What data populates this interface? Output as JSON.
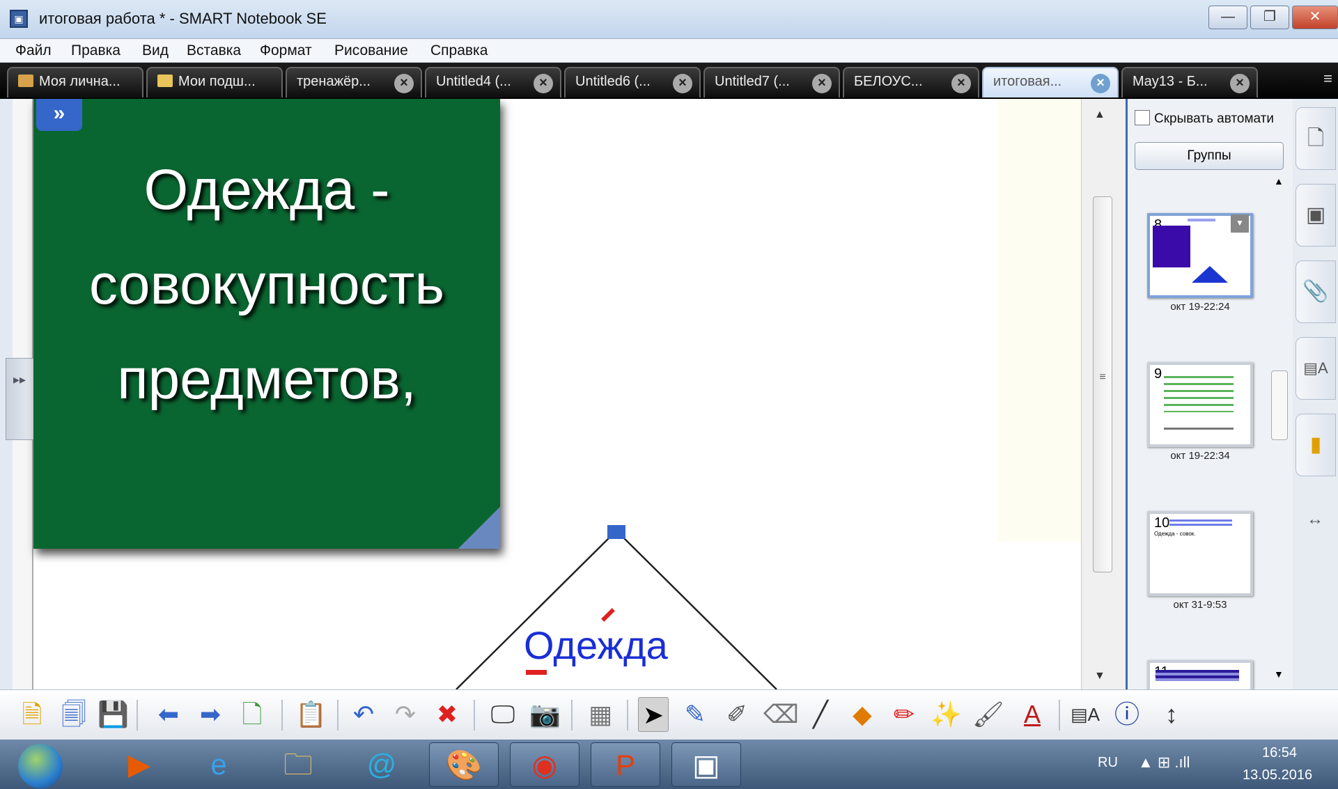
{
  "window": {
    "title": "итоговая работа * - SMART Notebook SE",
    "app_icon": "smart-notebook-icon",
    "minimize": "—",
    "restore": "❐",
    "close": "✕"
  },
  "menu": [
    "Файл",
    "Правка",
    "Вид",
    "Вставка",
    "Формат",
    "Рисование",
    "Справка"
  ],
  "tabs": [
    {
      "label": "Моя лична...",
      "icon": "house-icon"
    },
    {
      "label": "Мои подш...",
      "icon": "folder-icon"
    },
    {
      "label": "тренажёр...",
      "close": "×"
    },
    {
      "label": "Untitled4 (...",
      "close": "×"
    },
    {
      "label": "Untitled6 (...",
      "close": "×"
    },
    {
      "label": "Untitled7 (...",
      "close": "×"
    },
    {
      "label": "БЕЛОУС...",
      "close": "×"
    },
    {
      "label": "итоговая...",
      "close": "×",
      "active": true
    },
    {
      "label": "May13 - Б...",
      "close": "×"
    }
  ],
  "tabs_menu": "≡",
  "canvas": {
    "card_badge": "»",
    "card_lines": [
      "Одежда -",
      "совокупность",
      "предметов,"
    ],
    "card_color": "#0a6631",
    "triangle_word": "Одежда",
    "triangle_badge": "»"
  },
  "side_panel": {
    "autohide_label": "Скрывать автомати",
    "groups_button": "Группы",
    "thumbnails": [
      {
        "num": "8",
        "date": "окт 19-22:24",
        "selected": true
      },
      {
        "num": "9",
        "date": "окт 19-22:34"
      },
      {
        "num": "10",
        "date": "окт 31-9:53",
        "snippet": "Одежда - совок."
      },
      {
        "num": "11",
        "date": ""
      }
    ]
  },
  "right_tabs": [
    "page-sorter-icon",
    "gallery-icon",
    "attachments-icon",
    "properties-icon",
    "addons-icon"
  ],
  "right_tabs_extra": "↔",
  "toolbar": {
    "tools": [
      "new-page-icon",
      "add-page-icon",
      "save-icon",
      "back-arrow-icon",
      "forward-arrow-icon",
      "add-blank-page-icon",
      "paste-icon",
      "undo-icon",
      "redo-icon",
      "delete-icon",
      "screen-shade-icon",
      "screen-capture-icon",
      "table-icon",
      "select-icon",
      "pen-icon",
      "creative-pen-icon",
      "eraser-icon",
      "line-icon",
      "shapes-icon",
      "magic-pen-icon",
      "fill-icon",
      "text-icon",
      "properties-icon",
      "smart-response-icon",
      "move-toolbar-icon"
    ],
    "text_tool_label": "A",
    "move_label": "↕"
  },
  "taskbar": {
    "apps": [
      "media-player-icon",
      "internet-explorer-icon",
      "file-manager-icon",
      "mail-icon",
      "paint-icon",
      "chrome-icon",
      "powerpoint-icon",
      "smart-notebook-icon"
    ],
    "lang": "RU",
    "tray": "▲ ⊞ .ıll",
    "time": "16:54",
    "date": "13.05.2016"
  }
}
